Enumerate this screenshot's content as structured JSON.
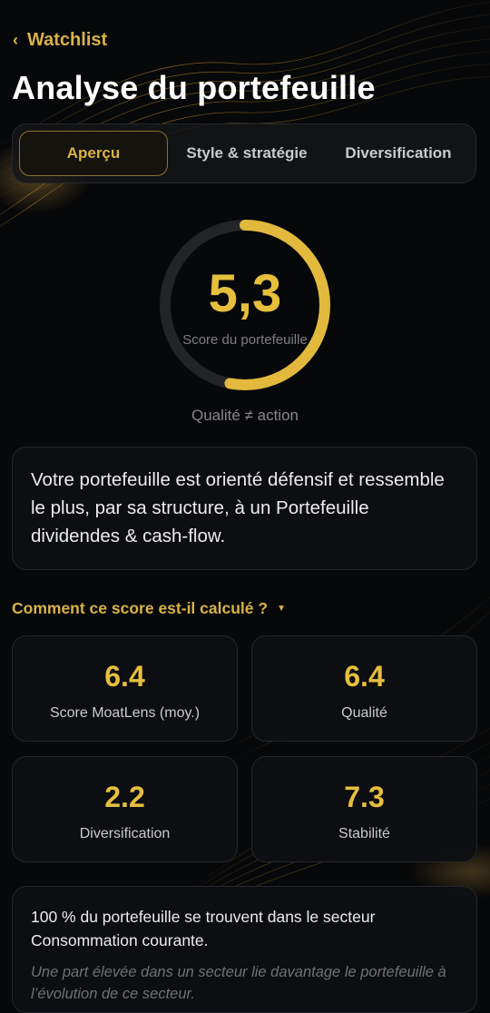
{
  "header": {
    "back_label": "Watchlist",
    "title": "Analyse du portefeuille"
  },
  "tabs": [
    {
      "label": "Aperçu",
      "active": true
    },
    {
      "label": "Style & stratégie",
      "active": false
    },
    {
      "label": "Diversification",
      "active": false
    }
  ],
  "score": {
    "value": "5,3",
    "max": 10,
    "label": "Score du portefeuille",
    "subtitle": "Qualité ≠ action"
  },
  "summary": {
    "text": "Votre portefeuille est orienté défensif et ressemble le plus, par sa structure, à un Portefeuille dividendes & cash-flow."
  },
  "calculation_toggle": {
    "label": "Comment ce score est-il calculé ?"
  },
  "metrics": [
    {
      "value": "6.4",
      "label": "Score MoatLens (moy.)"
    },
    {
      "value": "6.4",
      "label": "Qualité"
    },
    {
      "value": "2.2",
      "label": "Diversification"
    },
    {
      "value": "7.3",
      "label": "Stabilité"
    }
  ],
  "sector": {
    "text": "100 % du portefeuille se trouvent dans le secteur Consommation courante.",
    "note": "Une part élevée dans un secteur lie davantage le portefeuille à l’évolution de ce secteur."
  },
  "colors": {
    "background": "#07080a",
    "accent_gold": "#d9b248",
    "score_gold": "#e6bf3d",
    "card_bg": "#0e0f12",
    "gauge_track": "#232428"
  },
  "icons": {
    "back": "chevron-left-icon",
    "toggle": "caret-down-icon"
  }
}
